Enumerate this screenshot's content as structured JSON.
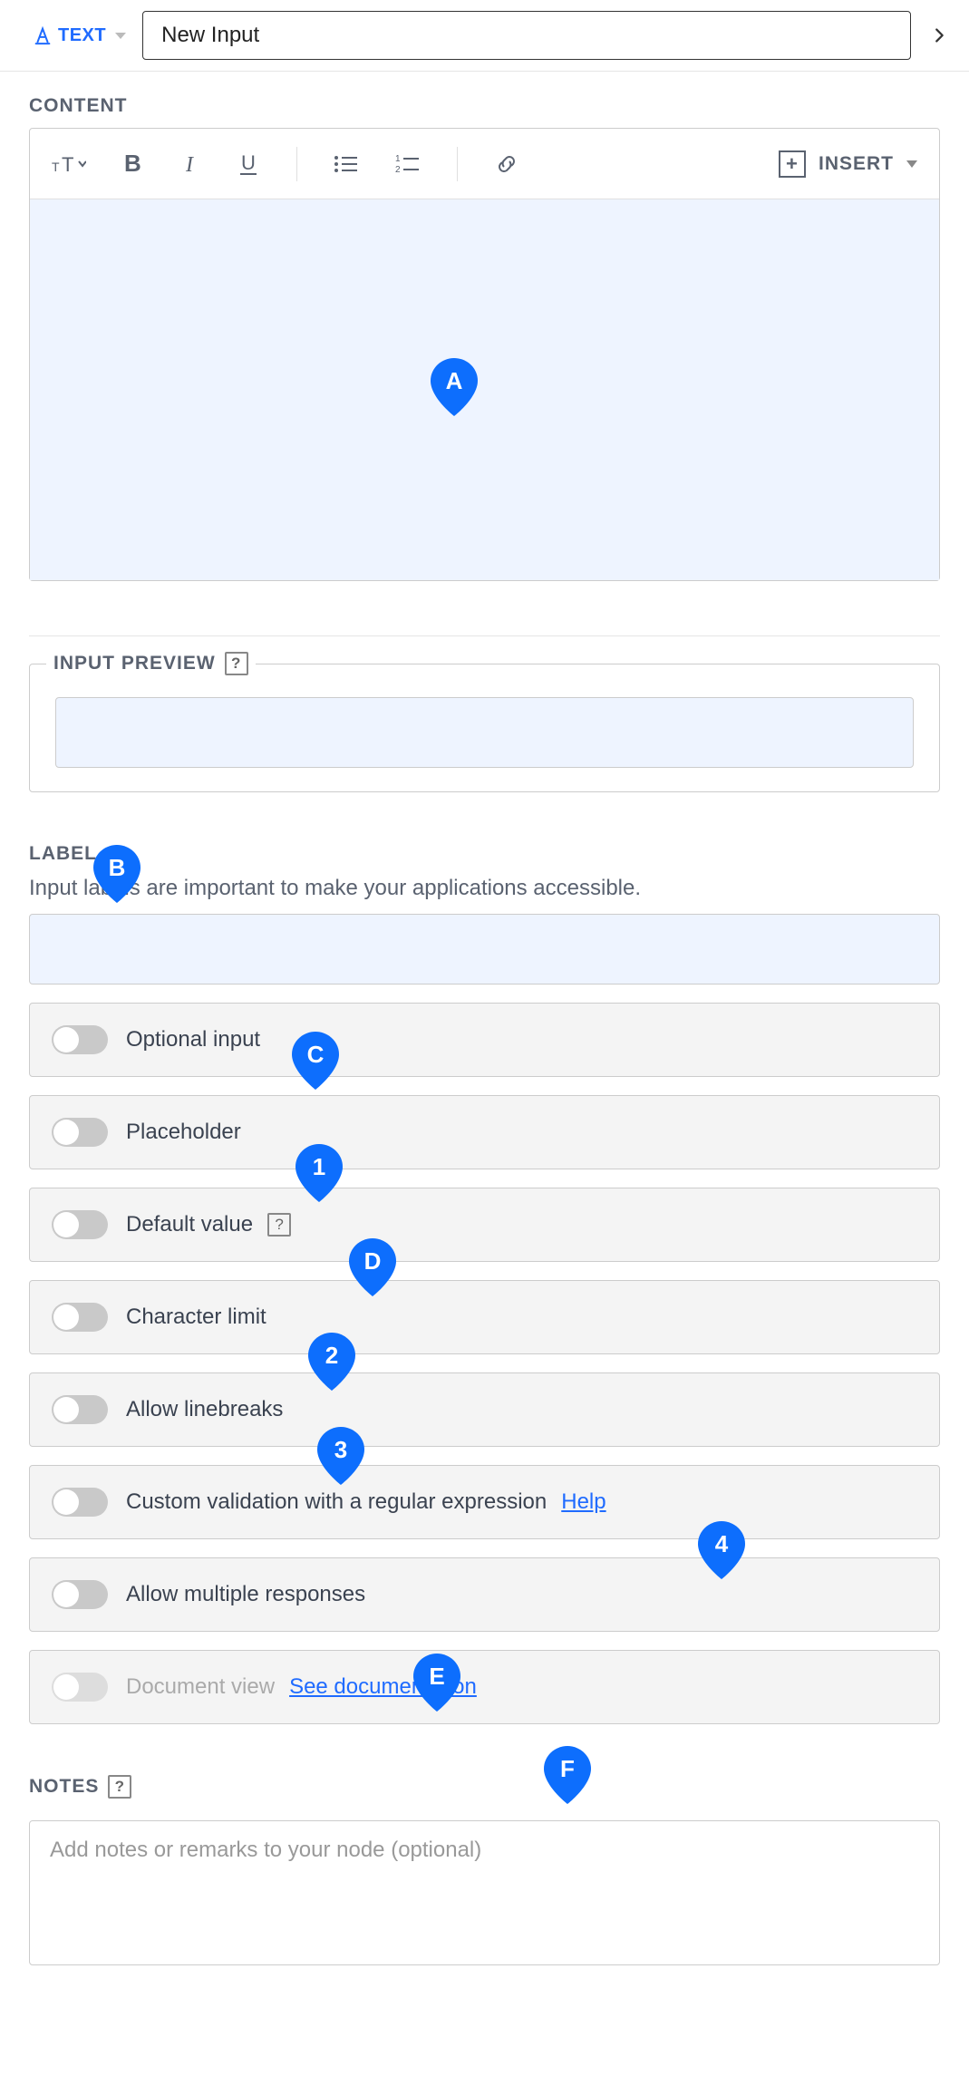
{
  "header": {
    "type_label": "TEXT",
    "title_value": "New Input"
  },
  "sections": {
    "content_label": "CONTENT",
    "insert_label": "INSERT",
    "input_preview_label": "INPUT PREVIEW",
    "label_heading": "LABEL",
    "label_hint": "Input labels are important to make your applications accessible.",
    "notes_label": "NOTES",
    "notes_placeholder": "Add notes or remarks to your node (optional)"
  },
  "toggles": {
    "optional": "Optional input",
    "placeholder": "Placeholder",
    "default_value": "Default value",
    "char_limit": "Character limit",
    "linebreaks": "Allow linebreaks",
    "custom_validation": "Custom validation with a regular expression",
    "help_link": "Help",
    "multiple_responses": "Allow multiple responses",
    "document_view": "Document view",
    "doc_link": "See documentation"
  },
  "markers": {
    "A": "A",
    "B": "B",
    "C": "C",
    "D": "D",
    "E": "E",
    "F": "F",
    "n1": "1",
    "n2": "2",
    "n3": "3",
    "n4": "4"
  }
}
